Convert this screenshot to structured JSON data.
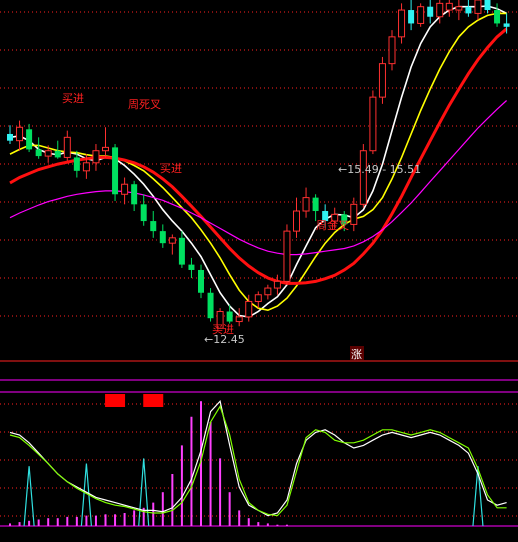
{
  "colors": {
    "background": "#000000",
    "up_candle": "#ff3030",
    "down_candle": "#00e060",
    "flat_candle": "#30f0f0",
    "ma_fast": "#ffffff",
    "ma_mid": "#ffff00",
    "ma_slow": "#ff1010",
    "ma_long": "#ff00ff",
    "grid": "#ff2020",
    "label": "#ff2020",
    "axis_text": "#c8c8c8",
    "osc_line_a": "#ffffff",
    "osc_line_b": "#80ff00",
    "osc_spike": "#30e0e0",
    "osc_bar": "#ff40ff",
    "alert_box": "#ff0000"
  },
  "annotations": {
    "buy_labels": [
      "买进",
      "买进",
      "买进"
    ],
    "death_cross": "周死叉",
    "golden_cross": "周金叉",
    "low_marker": "12.45",
    "range_marker": "15.49 - 15.51",
    "rise_badge": "涨"
  },
  "chart_data": [
    {
      "type": "candlestick",
      "panel": "price",
      "candles": [
        {
          "o": 15.35,
          "h": 15.48,
          "l": 15.2,
          "c": 15.25,
          "dir": "flat"
        },
        {
          "o": 15.25,
          "h": 15.55,
          "l": 15.1,
          "c": 15.45,
          "dir": "up"
        },
        {
          "o": 15.42,
          "h": 15.5,
          "l": 15.08,
          "c": 15.12,
          "dir": "down"
        },
        {
          "o": 15.12,
          "h": 15.3,
          "l": 14.98,
          "c": 15.02,
          "dir": "down"
        },
        {
          "o": 15.02,
          "h": 15.18,
          "l": 14.92,
          "c": 15.1,
          "dir": "up"
        },
        {
          "o": 15.1,
          "h": 15.25,
          "l": 14.98,
          "c": 15.0,
          "dir": "down"
        },
        {
          "o": 15.0,
          "h": 15.4,
          "l": 14.95,
          "c": 15.3,
          "dir": "up"
        },
        {
          "o": 15.0,
          "h": 15.1,
          "l": 14.7,
          "c": 14.8,
          "dir": "down"
        },
        {
          "o": 14.8,
          "h": 15.05,
          "l": 14.68,
          "c": 14.92,
          "dir": "up"
        },
        {
          "o": 14.92,
          "h": 15.2,
          "l": 14.8,
          "c": 15.1,
          "dir": "up"
        },
        {
          "o": 15.1,
          "h": 15.45,
          "l": 15.0,
          "c": 15.15,
          "dir": "up"
        },
        {
          "o": 15.15,
          "h": 15.2,
          "l": 14.35,
          "c": 14.45,
          "dir": "down"
        },
        {
          "o": 14.45,
          "h": 14.7,
          "l": 14.3,
          "c": 14.6,
          "dir": "up"
        },
        {
          "o": 14.6,
          "h": 14.65,
          "l": 14.2,
          "c": 14.3,
          "dir": "down"
        },
        {
          "o": 14.3,
          "h": 14.45,
          "l": 13.98,
          "c": 14.05,
          "dir": "down"
        },
        {
          "o": 14.05,
          "h": 14.2,
          "l": 13.8,
          "c": 13.9,
          "dir": "down"
        },
        {
          "o": 13.9,
          "h": 14.0,
          "l": 13.65,
          "c": 13.72,
          "dir": "down"
        },
        {
          "o": 13.72,
          "h": 13.85,
          "l": 13.55,
          "c": 13.8,
          "dir": "up"
        },
        {
          "o": 13.8,
          "h": 13.9,
          "l": 13.35,
          "c": 13.4,
          "dir": "down"
        },
        {
          "o": 13.4,
          "h": 13.5,
          "l": 13.2,
          "c": 13.32,
          "dir": "down"
        },
        {
          "o": 13.32,
          "h": 13.4,
          "l": 12.9,
          "c": 12.98,
          "dir": "down"
        },
        {
          "o": 12.98,
          "h": 13.05,
          "l": 12.55,
          "c": 12.6,
          "dir": "down"
        },
        {
          "o": 12.45,
          "h": 12.75,
          "l": 12.45,
          "c": 12.7,
          "dir": "up"
        },
        {
          "o": 12.7,
          "h": 12.8,
          "l": 12.52,
          "c": 12.55,
          "dir": "down"
        },
        {
          "o": 12.55,
          "h": 12.75,
          "l": 12.48,
          "c": 12.62,
          "dir": "up"
        },
        {
          "o": 12.62,
          "h": 12.95,
          "l": 12.55,
          "c": 12.85,
          "dir": "up"
        },
        {
          "o": 12.85,
          "h": 13.0,
          "l": 12.75,
          "c": 12.95,
          "dir": "up"
        },
        {
          "o": 12.95,
          "h": 13.1,
          "l": 12.88,
          "c": 13.05,
          "dir": "up"
        },
        {
          "o": 13.05,
          "h": 13.25,
          "l": 12.95,
          "c": 13.15,
          "dir": "up"
        },
        {
          "o": 13.15,
          "h": 14.0,
          "l": 13.1,
          "c": 13.9,
          "dir": "up"
        },
        {
          "o": 13.9,
          "h": 14.4,
          "l": 13.8,
          "c": 14.2,
          "dir": "up"
        },
        {
          "o": 14.2,
          "h": 14.55,
          "l": 14.1,
          "c": 14.4,
          "dir": "up"
        },
        {
          "o": 14.4,
          "h": 14.45,
          "l": 14.05,
          "c": 14.2,
          "dir": "down"
        },
        {
          "o": 14.2,
          "h": 14.3,
          "l": 13.95,
          "c": 14.05,
          "dir": "flat"
        },
        {
          "o": 14.05,
          "h": 14.25,
          "l": 13.95,
          "c": 14.15,
          "dir": "up"
        },
        {
          "o": 14.15,
          "h": 14.2,
          "l": 13.9,
          "c": 14.0,
          "dir": "down"
        },
        {
          "o": 14.0,
          "h": 14.4,
          "l": 13.9,
          "c": 14.3,
          "dir": "up"
        },
        {
          "o": 14.3,
          "h": 15.2,
          "l": 14.25,
          "c": 15.1,
          "dir": "up"
        },
        {
          "o": 15.1,
          "h": 16.0,
          "l": 15.05,
          "c": 15.9,
          "dir": "up"
        },
        {
          "o": 15.9,
          "h": 16.5,
          "l": 15.8,
          "c": 16.4,
          "dir": "up"
        },
        {
          "o": 16.4,
          "h": 16.9,
          "l": 16.3,
          "c": 16.8,
          "dir": "up"
        },
        {
          "o": 16.8,
          "h": 17.3,
          "l": 16.7,
          "c": 17.2,
          "dir": "up"
        },
        {
          "o": 17.2,
          "h": 17.35,
          "l": 16.9,
          "c": 17.0,
          "dir": "flat"
        },
        {
          "o": 17.0,
          "h": 17.3,
          "l": 16.95,
          "c": 17.25,
          "dir": "up"
        },
        {
          "o": 17.25,
          "h": 17.4,
          "l": 17.0,
          "c": 17.1,
          "dir": "flat"
        },
        {
          "o": 17.1,
          "h": 17.35,
          "l": 17.0,
          "c": 17.3,
          "dir": "up"
        },
        {
          "o": 17.3,
          "h": 17.4,
          "l": 17.1,
          "c": 17.2,
          "dir": "up"
        },
        {
          "o": 17.2,
          "h": 17.35,
          "l": 17.05,
          "c": 17.25,
          "dir": "up"
        },
        {
          "o": 17.25,
          "h": 17.4,
          "l": 17.1,
          "c": 17.15,
          "dir": "flat"
        },
        {
          "o": 17.15,
          "h": 17.4,
          "l": 17.05,
          "c": 17.35,
          "dir": "up"
        },
        {
          "o": 17.35,
          "h": 17.45,
          "l": 17.15,
          "c": 17.2,
          "dir": "flat"
        },
        {
          "o": 17.2,
          "h": 17.3,
          "l": 16.95,
          "c": 17.0,
          "dir": "down"
        },
        {
          "o": 17.0,
          "h": 17.15,
          "l": 16.85,
          "c": 16.95,
          "dir": "flat"
        }
      ],
      "y_range": [
        12.2,
        17.35
      ],
      "grid": true,
      "ma_lines": [
        {
          "key": "ma_fast",
          "values": [
            15.3,
            15.32,
            15.25,
            15.12,
            15.06,
            15.04,
            15.08,
            15.05,
            14.98,
            14.95,
            15.0,
            14.98,
            14.88,
            14.75,
            14.6,
            14.42,
            14.22,
            14.05,
            13.9,
            13.72,
            13.52,
            13.25,
            12.98,
            12.78,
            12.64,
            12.62,
            12.7,
            12.82,
            12.92,
            13.1,
            13.4,
            13.68,
            13.95,
            14.08,
            14.15,
            14.14,
            14.1,
            14.22,
            14.5,
            14.9,
            15.4,
            15.9,
            16.35,
            16.7,
            16.95,
            17.1,
            17.2,
            17.25,
            17.25,
            17.25,
            17.26,
            17.22,
            17.15
          ]
        },
        {
          "key": "ma_mid",
          "values": [
            15.05,
            15.12,
            15.18,
            15.18,
            15.14,
            15.1,
            15.08,
            15.07,
            15.04,
            15.02,
            15.02,
            15.0,
            14.95,
            14.88,
            14.8,
            14.68,
            14.55,
            14.4,
            14.25,
            14.1,
            13.92,
            13.72,
            13.5,
            13.25,
            13.02,
            12.85,
            12.75,
            12.72,
            12.78,
            12.9,
            13.08,
            13.3,
            13.52,
            13.72,
            13.88,
            14.0,
            14.08,
            14.12,
            14.22,
            14.4,
            14.68,
            15.0,
            15.35,
            15.7,
            16.02,
            16.32,
            16.58,
            16.8,
            16.95,
            17.05,
            17.12,
            17.15,
            17.15
          ]
        },
        {
          "key": "ma_slow",
          "values": [
            14.62,
            14.7,
            14.76,
            14.82,
            14.86,
            14.9,
            14.93,
            14.96,
            14.98,
            15.0,
            15.0,
            14.99,
            14.96,
            14.92,
            14.86,
            14.78,
            14.68,
            14.56,
            14.42,
            14.27,
            14.12,
            13.96,
            13.8,
            13.64,
            13.5,
            13.38,
            13.28,
            13.2,
            13.15,
            13.12,
            13.12,
            13.13,
            13.15,
            13.19,
            13.24,
            13.32,
            13.42,
            13.56,
            13.72,
            13.92,
            14.16,
            14.42,
            14.7,
            14.98,
            15.25,
            15.52,
            15.78,
            16.02,
            16.25,
            16.46,
            16.64,
            16.8,
            16.92
          ]
        },
        {
          "key": "ma_long",
          "values": [
            14.1,
            14.17,
            14.23,
            14.29,
            14.34,
            14.38,
            14.42,
            14.45,
            14.47,
            14.49,
            14.5,
            14.5,
            14.49,
            14.47,
            14.44,
            14.4,
            14.36,
            14.3,
            14.24,
            14.17,
            14.1,
            14.02,
            13.94,
            13.86,
            13.78,
            13.71,
            13.65,
            13.6,
            13.57,
            13.55,
            13.55,
            13.56,
            13.58,
            13.6,
            13.62,
            13.64,
            13.68,
            13.74,
            13.82,
            13.92,
            14.04,
            14.18,
            14.32,
            14.48,
            14.64,
            14.8,
            14.96,
            15.12,
            15.28,
            15.44,
            15.58,
            15.72,
            15.85
          ]
        }
      ]
    },
    {
      "type": "line",
      "panel": "oscillator",
      "y_range": [
        0,
        100
      ],
      "series": [
        {
          "key": "osc_line_a",
          "values": [
            72,
            70,
            64,
            56,
            48,
            40,
            34,
            30,
            26,
            22,
            20,
            18,
            16,
            14,
            12,
            12,
            11,
            14,
            22,
            36,
            58,
            88,
            96,
            62,
            30,
            16,
            12,
            8,
            10,
            20,
            48,
            66,
            72,
            74,
            70,
            64,
            60,
            62,
            66,
            70,
            72,
            70,
            68,
            70,
            72,
            70,
            66,
            62,
            56,
            40,
            20,
            16,
            18
          ]
        },
        {
          "key": "osc_line_b",
          "values": [
            70,
            68,
            62,
            55,
            48,
            40,
            34,
            29,
            25,
            21,
            18,
            16,
            15,
            13,
            11,
            10,
            10,
            12,
            18,
            30,
            50,
            80,
            92,
            70,
            36,
            18,
            12,
            9,
            8,
            16,
            42,
            68,
            74,
            72,
            66,
            64,
            64,
            66,
            70,
            74,
            74,
            72,
            70,
            72,
            74,
            72,
            68,
            64,
            60,
            44,
            24,
            14,
            14
          ]
        }
      ],
      "spikes": [
        {
          "index": 2,
          "value": 46
        },
        {
          "index": 8,
          "value": 48
        },
        {
          "index": 14,
          "value": 52
        },
        {
          "index": 49,
          "value": 46
        }
      ],
      "bars": [
        2,
        3,
        4,
        5,
        6,
        6,
        7,
        7,
        8,
        8,
        9,
        9,
        10,
        12,
        14,
        18,
        26,
        40,
        62,
        84,
        96,
        80,
        52,
        26,
        12,
        6,
        3,
        2,
        1,
        1,
        0,
        0,
        0,
        0,
        0,
        0,
        0,
        0,
        0,
        0,
        0,
        0,
        0,
        0,
        0,
        0,
        0,
        0,
        0,
        0,
        0,
        0,
        0
      ],
      "alerts": [
        {
          "index": 11
        },
        {
          "index": 15
        }
      ]
    }
  ]
}
